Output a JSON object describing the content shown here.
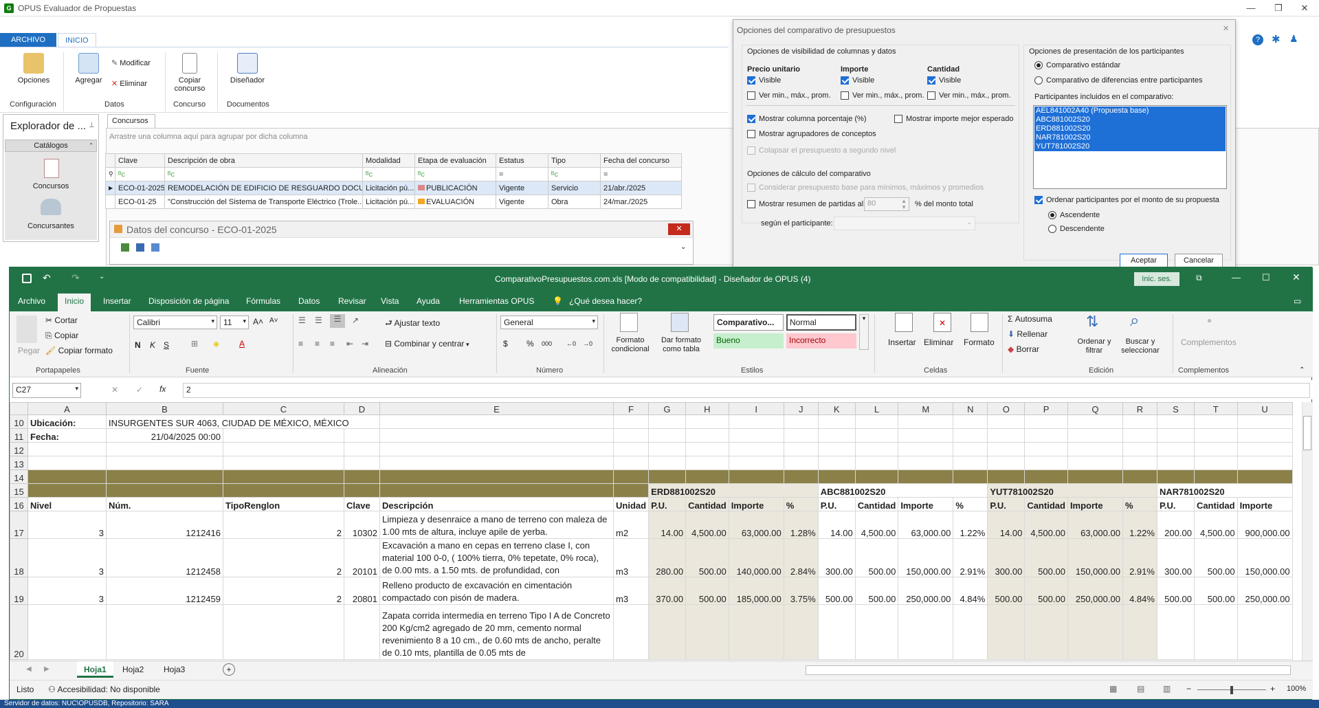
{
  "opus": {
    "title": "OPUS Evaluador de Propuestas",
    "tabs": [
      "ARCHIVO",
      "INICIO"
    ],
    "ribbon": {
      "opciones": "Opciones",
      "agregar": "Agregar",
      "modificar": "Modificar",
      "eliminar": "Eliminar",
      "copiar": "Copiar concurso",
      "disenador": "Diseñador"
    },
    "groups": [
      "Configuración",
      "Datos",
      "Concurso",
      "Documentos"
    ],
    "explorer": {
      "title": "Explorador de ...",
      "catalogos": "Catálogos",
      "concursos": "Concursos",
      "concursantes": "Concursantes"
    },
    "concursos_tab": "Concursos",
    "group_hint": "Arrastre una columna aquí para agrupar por dicha columna",
    "columns": [
      "Clave",
      "Descripción de obra",
      "Modalidad",
      "Etapa de evaluación",
      "Estatus",
      "Tipo",
      "Fecha del concurso"
    ],
    "rows": [
      [
        "ECO-01-2025",
        "REMODELACIÓN DE EDIFICIO DE RESGUARDO DOCUM...",
        "Licitación pú...",
        "PUBLICACIÓN",
        "Vigente",
        "Servicio",
        "21/abr./2025"
      ],
      [
        "ECO-01-25",
        "\"Construcción del Sistema de Transporte Eléctrico (Trole...",
        "Licitación pú...",
        "EVALUACIÓN",
        "Vigente",
        "Obra",
        "24/mar./2025"
      ]
    ],
    "datos_title": "Datos del concurso - ECO-01-2025",
    "footer": "Servidor de datos: NUC\\OPUSDB, Repositorio: SARA"
  },
  "dialog": {
    "title": "Opciones del comparativo de presupuestos",
    "vis_title": "Opciones de visibilidad de columnas y datos",
    "pu": "Precio unitario",
    "imp": "Importe",
    "cant": "Cantidad",
    "visible": "Visible",
    "vermin": "Ver min., máx., prom.",
    "porcentaje": "Mostrar columna porcentaje (%)",
    "mejor": "Mostrar importe mejor esperado",
    "agrupadores": "Mostrar agrupadores de conceptos",
    "colapsar": "Colapsar el presupuesto a segundo nivel",
    "calc_title": "Opciones de cálculo del comparativo",
    "considerar": "Considerar presupuesto base para mínimos, máximos y promedios",
    "resumen": "Mostrar resumen de partidas al",
    "resumen_val": "80",
    "monto": "% del monto total",
    "segun": "según el participante:",
    "pres_title": "Opciones de presentación de los participantes",
    "estandar": "Comparativo estándar",
    "diferencias": "Comparativo de diferencias entre participantes",
    "incluidos": "Participantes incluidos en el comparativo:",
    "participantes": [
      "AEL841002A40 (Propuesta base)",
      "ABC881002S20",
      "ERD881002S20",
      "NAR781002S20",
      "YUT781002S20"
    ],
    "ordenar": "Ordenar participantes por el monto de su propuesta",
    "asc": "Ascendente",
    "desc": "Descendente",
    "aceptar": "Aceptar",
    "cancelar": "Cancelar"
  },
  "excel": {
    "title": "ComparativoPresupuestos.com.xls  [Modo de compatibilidad]  -  Diseñador de OPUS (4)",
    "inic": "Inic. ses.",
    "menu": [
      "Archivo",
      "Inicio",
      "Insertar",
      "Disposición de página",
      "Fórmulas",
      "Datos",
      "Revisar",
      "Vista",
      "Ayuda",
      "Herramientas OPUS",
      "¿Qué desea hacer?"
    ],
    "ribbon": {
      "pegar": "Pegar",
      "cortar": "Cortar",
      "copiar": "Copiar",
      "copiar_formato": "Copiar formato",
      "font": "Calibri",
      "size": "11",
      "ajustar": "Ajustar texto",
      "combinar": "Combinar y centrar",
      "numfmt": "General",
      "fcond": "Formato condicional",
      "dartabla": "Dar formato como tabla",
      "estilos": [
        "Comparativo...",
        "Normal",
        "Bueno",
        "Incorrecto"
      ],
      "insertar": "Insertar",
      "eliminar": "Eliminar",
      "formato": "Formato",
      "autosuma": "Autosuma",
      "rellenar": "Rellenar",
      "borrar": "Borrar",
      "ordenar": "Ordenar y filtrar",
      "buscar": "Buscar y seleccionar",
      "complementos": "Complementos"
    },
    "groups": [
      "Portapapeles",
      "Fuente",
      "Alineación",
      "Número",
      "Estilos",
      "Celdas",
      "Edición",
      "Complementos"
    ],
    "namebox": "C27",
    "formula": "2",
    "cols": [
      "A",
      "B",
      "C",
      "D",
      "E",
      "F",
      "G",
      "H",
      "I",
      "J",
      "K",
      "L",
      "M",
      "N",
      "O",
      "P",
      "Q",
      "R",
      "S",
      "T",
      "U"
    ],
    "sheets": [
      "Hoja1",
      "Hoja2",
      "Hoja3"
    ],
    "status": "Listo",
    "accessibility": "Accesibilidad: No disponible",
    "zoom": "100%",
    "r10": {
      "label": "Ubicación:",
      "val": "INSURGENTES SUR 4063, CIUDAD DE MÉXICO, MÉXICO"
    },
    "r11": {
      "label": "Fecha:",
      "val": "21/04/2025 00:00"
    },
    "r15": [
      "ERD881002S20",
      "ABC881002S20",
      "YUT781002S20",
      "NAR781002S20"
    ],
    "r16": [
      "Nivel",
      "Núm.",
      "TipoRenglon",
      "Clave",
      "Descripción",
      "Unidad",
      "P.U.",
      "Cantidad",
      "Importe",
      "%",
      "P.U.",
      "Cantidad",
      "Importe",
      "%",
      "P.U.",
      "Cantidad",
      "Importe",
      "%",
      "P.U.",
      "Cantidad",
      "Importe"
    ],
    "r17": [
      "3",
      "1212416",
      "2",
      "10302",
      "Limpieza y desenraice a mano de terreno con maleza de 1.00 mts de altura, incluye apile de yerba.",
      "m2",
      "14.00",
      "4,500.00",
      "63,000.00",
      "1.28%",
      "14.00",
      "4,500.00",
      "63,000.00",
      "1.22%",
      "14.00",
      "4,500.00",
      "63,000.00",
      "1.22%",
      "200.00",
      "4,500.00",
      "900,000.00"
    ],
    "r18": [
      "3",
      "1212458",
      "2",
      "20101",
      "Excavación a mano en cepas en terreno clase I, con material 100 0-0, ( 100% tierra, 0% tepetate, 0% roca), de 0.00 mts. a 1.50 mts. de profundidad, con",
      "m3",
      "280.00",
      "500.00",
      "140,000.00",
      "2.84%",
      "300.00",
      "500.00",
      "150,000.00",
      "2.91%",
      "300.00",
      "500.00",
      "150,000.00",
      "2.91%",
      "300.00",
      "500.00",
      "150,000.00"
    ],
    "r19": [
      "3",
      "1212459",
      "2",
      "20801",
      "Relleno producto de excavación en cimentación compactado con pisón de madera.",
      "m3",
      "370.00",
      "500.00",
      "185,000.00",
      "3.75%",
      "500.00",
      "500.00",
      "250,000.00",
      "4.84%",
      "500.00",
      "500.00",
      "250,000.00",
      "4.84%",
      "500.00",
      "500.00",
      "250,000.00"
    ],
    "r20": "Zapata corrida intermedia en terreno Tipo I A de Concreto 200 Kg/cm2 agregado de 20 mm, cemento normal revenimiento 8 a 10 cm., de 0.60 mts de ancho,  peralte de 0.10 mts, plantilla de 0.05 mts de"
  }
}
